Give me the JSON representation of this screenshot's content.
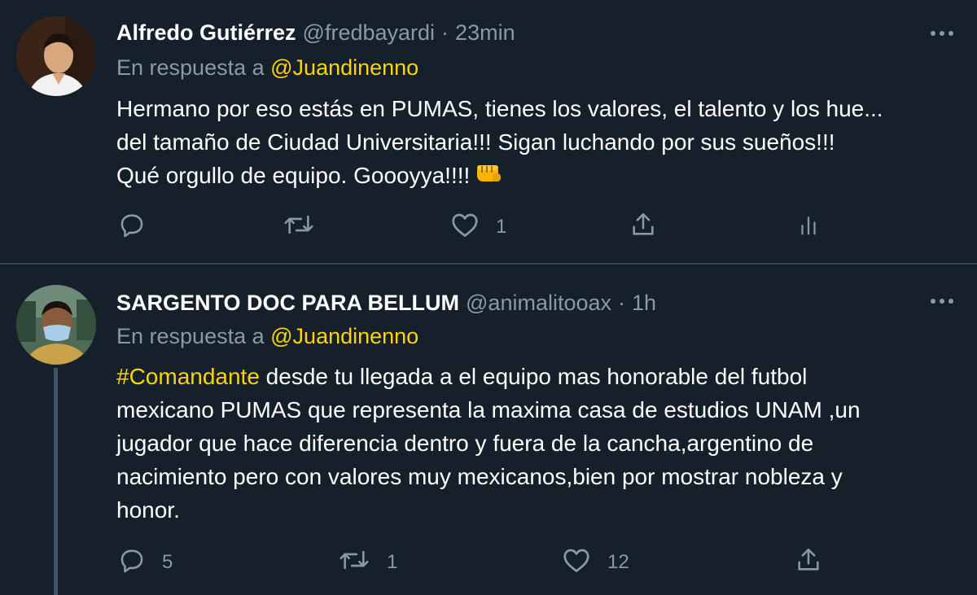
{
  "tweets": [
    {
      "name": "Alfredo Gutiérrez",
      "handle": "@fredbayardi",
      "separator": "·",
      "time": "23min",
      "reply_prefix": "En respuesta a",
      "reply_to": "@Juandinenno",
      "body_lines": [
        "Hermano por eso estás en PUMAS, tienes los valores, el talento y los hue...",
        "del tamaño de Ciudad Universitaria!!! Sigan luchando por sus sueños!!!",
        "Qué orgullo de equipo. Goooyya!!!!"
      ],
      "emoji": "oncoming-fist-icon",
      "actions": {
        "reply_count": "",
        "retweet_count": "",
        "like_count": "1"
      }
    },
    {
      "name": "SARGENTO DOC PARA BELLUM",
      "handle": "@animalitooax",
      "separator": "·",
      "time": "1h",
      "reply_prefix": "En respuesta a",
      "reply_to": "@Juandinenno",
      "hashtag": "#Comandante",
      "body_first_line_rest": " desde tu llegada a el equipo mas honorable del futbol",
      "body_lines": [
        "mexicano PUMAS que representa la maxima casa de estudios UNAM ,un",
        "jugador que hace diferencia dentro y fuera de la cancha,argentino de",
        "nacimiento pero con valores muy mexicanos,bien por mostrar nobleza  y",
        "honor."
      ],
      "actions": {
        "reply_count": "5",
        "retweet_count": "1",
        "like_count": "12"
      }
    }
  ],
  "colors": {
    "background": "#15202b",
    "secondary_text": "#8b98a5",
    "accent": "#ffd400",
    "divider": "#38444d"
  }
}
